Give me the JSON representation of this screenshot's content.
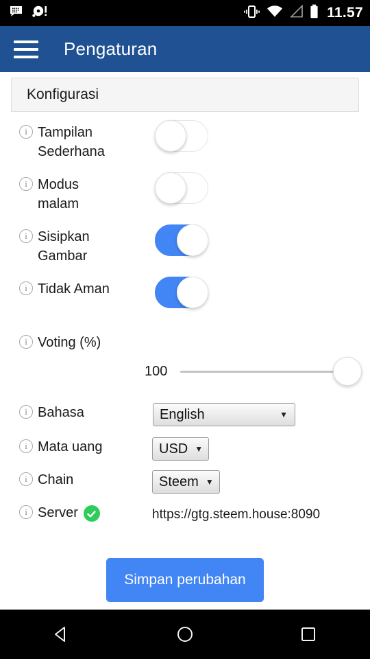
{
  "status_bar": {
    "notifications": [
      "bbm-chat-icon",
      "disc-alert-icon"
    ],
    "vibrate_icon": "vibrate-icon",
    "wifi_icon": "wifi-full-icon",
    "signal_icon": "signal-empty-icon",
    "battery_icon": "battery-icon",
    "clock": "11.57"
  },
  "app_bar": {
    "menu_icon": "hamburger-menu-icon",
    "title": "Pengaturan",
    "background_color": "#1f5193"
  },
  "panel": {
    "heading": "Konfigurasi"
  },
  "settings": {
    "toggles": [
      {
        "label": "Tampilan Sederhana",
        "state": "off",
        "info_icon": "info-icon"
      },
      {
        "label": "Modus malam",
        "state": "off",
        "info_icon": "info-icon"
      },
      {
        "label": "Sisipkan Gambar",
        "state": "on",
        "info_icon": "info-icon"
      },
      {
        "label": "Tidak Aman",
        "state": "on",
        "info_icon": "info-icon"
      }
    ],
    "slider": {
      "label": "Voting (%)",
      "value": "100",
      "min": 0,
      "max": 100,
      "percent": 100
    },
    "selects": [
      {
        "label": "Bahasa",
        "value": "English",
        "caret": "▼",
        "width": "wide"
      },
      {
        "label": "Mata uang",
        "value": "USD",
        "caret": "▼",
        "width": "auto"
      },
      {
        "label": "Chain",
        "value": "Steem",
        "caret": "▼",
        "width": "auto"
      }
    ],
    "server": {
      "label": "Server",
      "status_icon": "green-check-icon",
      "status_color": "#2ecc5a",
      "value": "https://gtg.steem.house:8090"
    }
  },
  "actions": {
    "save_label": "Simpan perubahan",
    "save_color": "#4285f4"
  },
  "nav_bar": {
    "back_icon": "back-triangle-icon",
    "home_icon": "home-circle-icon",
    "recents_icon": "recents-square-icon"
  },
  "colors": {
    "toggle_on": "#4285f4",
    "app_bar": "#1f5193",
    "panel_bg": "#f5f5f5",
    "green": "#2ecc5a"
  }
}
